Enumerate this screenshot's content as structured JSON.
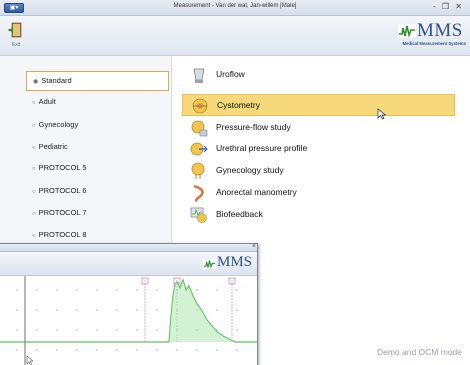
{
  "window": {
    "title": "Measurement - Van der wal, Jan-willem [Male]",
    "controls": "- ❐ ✕"
  },
  "ribbon": {
    "exit_label": "Exit"
  },
  "logo": {
    "text": "MMS",
    "subtitle": "Medical Measurement Systems"
  },
  "protocols": [
    {
      "label": "Standard",
      "selected": true
    },
    {
      "label": "Adult",
      "selected": false
    },
    {
      "label": "Gynecology",
      "selected": false
    },
    {
      "label": "Pediatric",
      "selected": false
    },
    {
      "label": "PROTOCOL 5",
      "selected": false
    },
    {
      "label": "PROTOCOL 6",
      "selected": false
    },
    {
      "label": "PROTOCOL 7",
      "selected": false
    },
    {
      "label": "PROTOCOL 8",
      "selected": false
    }
  ],
  "studies": [
    {
      "label": "Uroflow",
      "icon": "uroflow-icon"
    },
    {
      "label": "Cystometry",
      "icon": "cystometry-icon",
      "highlighted": true
    },
    {
      "label": "Pressure-flow study",
      "icon": "pressure-flow-icon"
    },
    {
      "label": "Urethral pressure profile",
      "icon": "urethral-profile-icon"
    },
    {
      "label": "Gynecology study",
      "icon": "gynecology-icon"
    },
    {
      "label": "Anorectal manometry",
      "icon": "anorectal-icon"
    },
    {
      "label": "Biofeedback",
      "icon": "biofeedback-icon"
    }
  ],
  "status": {
    "mode": "Demo and OCM mode"
  },
  "overlay": {
    "logo_text": "MMS",
    "close_label": "×"
  },
  "colors": {
    "highlight": "#f6d97a",
    "accent_border": "#e0a84e",
    "brand": "#31528b",
    "trace": "#3fb13f"
  }
}
